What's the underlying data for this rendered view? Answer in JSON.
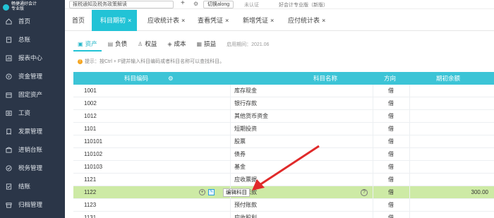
{
  "sidebar": {
    "brand_line1": "畅捷通好会计",
    "brand_line2": "专业版",
    "items": [
      {
        "label": "首页",
        "icon": "home-icon"
      },
      {
        "label": "总账",
        "icon": "ledger-icon"
      },
      {
        "label": "报表中心",
        "icon": "report-icon"
      },
      {
        "label": "资金管理",
        "icon": "money-icon"
      },
      {
        "label": "固定资产",
        "icon": "asset-icon"
      },
      {
        "label": "工资",
        "icon": "salary-icon"
      },
      {
        "label": "发票管理",
        "icon": "invoice-icon"
      },
      {
        "label": "进销台账",
        "icon": "inventory-icon"
      },
      {
        "label": "税务管理",
        "icon": "tax-icon"
      },
      {
        "label": "结账",
        "icon": "closing-icon"
      },
      {
        "label": "归档管理",
        "icon": "archive-icon"
      }
    ]
  },
  "topbar": {
    "notice": "报税通知及税务政策解读",
    "plus": "+",
    "switch_label": "切换along",
    "cert": "未认证",
    "edition": "好会计专业版（新版）"
  },
  "tabs": [
    {
      "label": "首页",
      "closable": false
    },
    {
      "label": "科目期初",
      "closable": true,
      "active": true
    },
    {
      "label": "应收统计表",
      "closable": true
    },
    {
      "label": "查看凭证",
      "closable": true
    },
    {
      "label": "新增凭证",
      "closable": true
    },
    {
      "label": "应付统计表",
      "closable": true
    }
  ],
  "subtabs": [
    {
      "label": "资产",
      "active": true
    },
    {
      "label": "负债"
    },
    {
      "label": "权益"
    },
    {
      "label": "成本"
    },
    {
      "label": "损益"
    }
  ],
  "period_label": "启用期间：2021.06",
  "tip": "提示：按Ctrl + F键并输入科目编码或者科目名称可以查找科目。",
  "table": {
    "headers": {
      "code": "科目编码",
      "name": "科目名称",
      "direction": "方向",
      "balance": "期初余额"
    },
    "rows": [
      {
        "code": "1001",
        "name": "库存现金",
        "direction": "借",
        "balance": ""
      },
      {
        "code": "1002",
        "name": "银行存款",
        "direction": "借",
        "balance": ""
      },
      {
        "code": "1012",
        "name": "其他货币资金",
        "direction": "借",
        "balance": ""
      },
      {
        "code": "1101",
        "name": "短期投资",
        "direction": "借",
        "balance": ""
      },
      {
        "code": "110101",
        "name": "股票",
        "direction": "借",
        "balance": ""
      },
      {
        "code": "110102",
        "name": "债券",
        "direction": "借",
        "balance": ""
      },
      {
        "code": "110103",
        "name": "基金",
        "direction": "借",
        "balance": ""
      },
      {
        "code": "1121",
        "name": "应收票据",
        "direction": "借",
        "balance": ""
      },
      {
        "code": "1122",
        "name": "应收账款",
        "direction": "借",
        "balance": "300.00"
      },
      {
        "code": "1123",
        "name": "预付账款",
        "direction": "借",
        "balance": ""
      },
      {
        "code": "1131",
        "name": "应收股利",
        "direction": "借",
        "balance": ""
      }
    ],
    "tooltip": "编辑科目",
    "qmark": "?"
  },
  "colors": {
    "accent": "#22c3d6",
    "sidebar": "#2b3648",
    "highlight_row": "#cdeaa5",
    "arrow": "#e02a2a"
  }
}
